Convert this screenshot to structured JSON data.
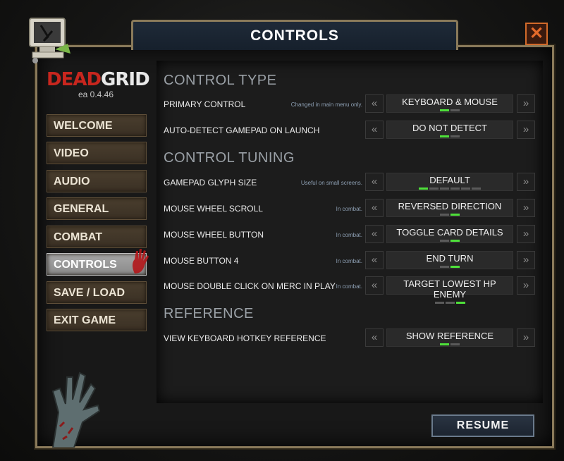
{
  "window": {
    "title": "CONTROLS",
    "close_icon": "close-icon"
  },
  "logo": {
    "dead": "DEAD",
    "grid": "GRID",
    "version": "ea 0.4.46"
  },
  "sidebar": {
    "items": [
      {
        "label": "WELCOME",
        "active": false
      },
      {
        "label": "VIDEO",
        "active": false
      },
      {
        "label": "AUDIO",
        "active": false
      },
      {
        "label": "GENERAL",
        "active": false
      },
      {
        "label": "COMBAT",
        "active": false
      },
      {
        "label": "CONTROLS",
        "active": true
      },
      {
        "label": "SAVE / LOAD",
        "active": false
      },
      {
        "label": "EXIT GAME",
        "active": false
      }
    ]
  },
  "sections": {
    "control_type": "CONTROL TYPE",
    "control_tuning": "CONTROL TUNING",
    "reference": "REFERENCE"
  },
  "settings": [
    {
      "label": "PRIMARY CONTROL",
      "note": "Changed in main menu only.",
      "value": "KEYBOARD & MOUSE",
      "options": 2,
      "selected": 0
    },
    {
      "label": "AUTO-DETECT GAMEPAD ON LAUNCH",
      "note": "",
      "value": "DO NOT DETECT",
      "options": 2,
      "selected": 0
    },
    {
      "label": "GAMEPAD GLYPH SIZE",
      "note": "Useful on small screens.",
      "value": "DEFAULT",
      "options": 6,
      "selected": 0
    },
    {
      "label": "MOUSE WHEEL SCROLL",
      "note": "In combat.",
      "value": "REVERSED DIRECTION",
      "options": 2,
      "selected": 1
    },
    {
      "label": "MOUSE WHEEL BUTTON",
      "note": "In combat.",
      "value": "TOGGLE CARD DETAILS",
      "options": 2,
      "selected": 1
    },
    {
      "label": "MOUSE BUTTON 4",
      "note": "In combat.",
      "value": "END TURN",
      "options": 2,
      "selected": 1
    },
    {
      "label": "MOUSE DOUBLE CLICK ON MERC IN PLAY",
      "note": "In combat.",
      "value": "TARGET LOWEST HP ENEMY",
      "options": 3,
      "selected": 2
    },
    {
      "label": "VIEW KEYBOARD HOTKEY REFERENCE",
      "note": "",
      "value": "SHOW REFERENCE",
      "options": 2,
      "selected": 0
    }
  ],
  "arrows": {
    "left": "«",
    "right": "»"
  },
  "colors": {
    "pip_on": "#4ee03a",
    "pip_off": "#5a5a5a",
    "accent_frame": "#8a7a5a"
  },
  "footer": {
    "resume_label": "RESUME"
  }
}
